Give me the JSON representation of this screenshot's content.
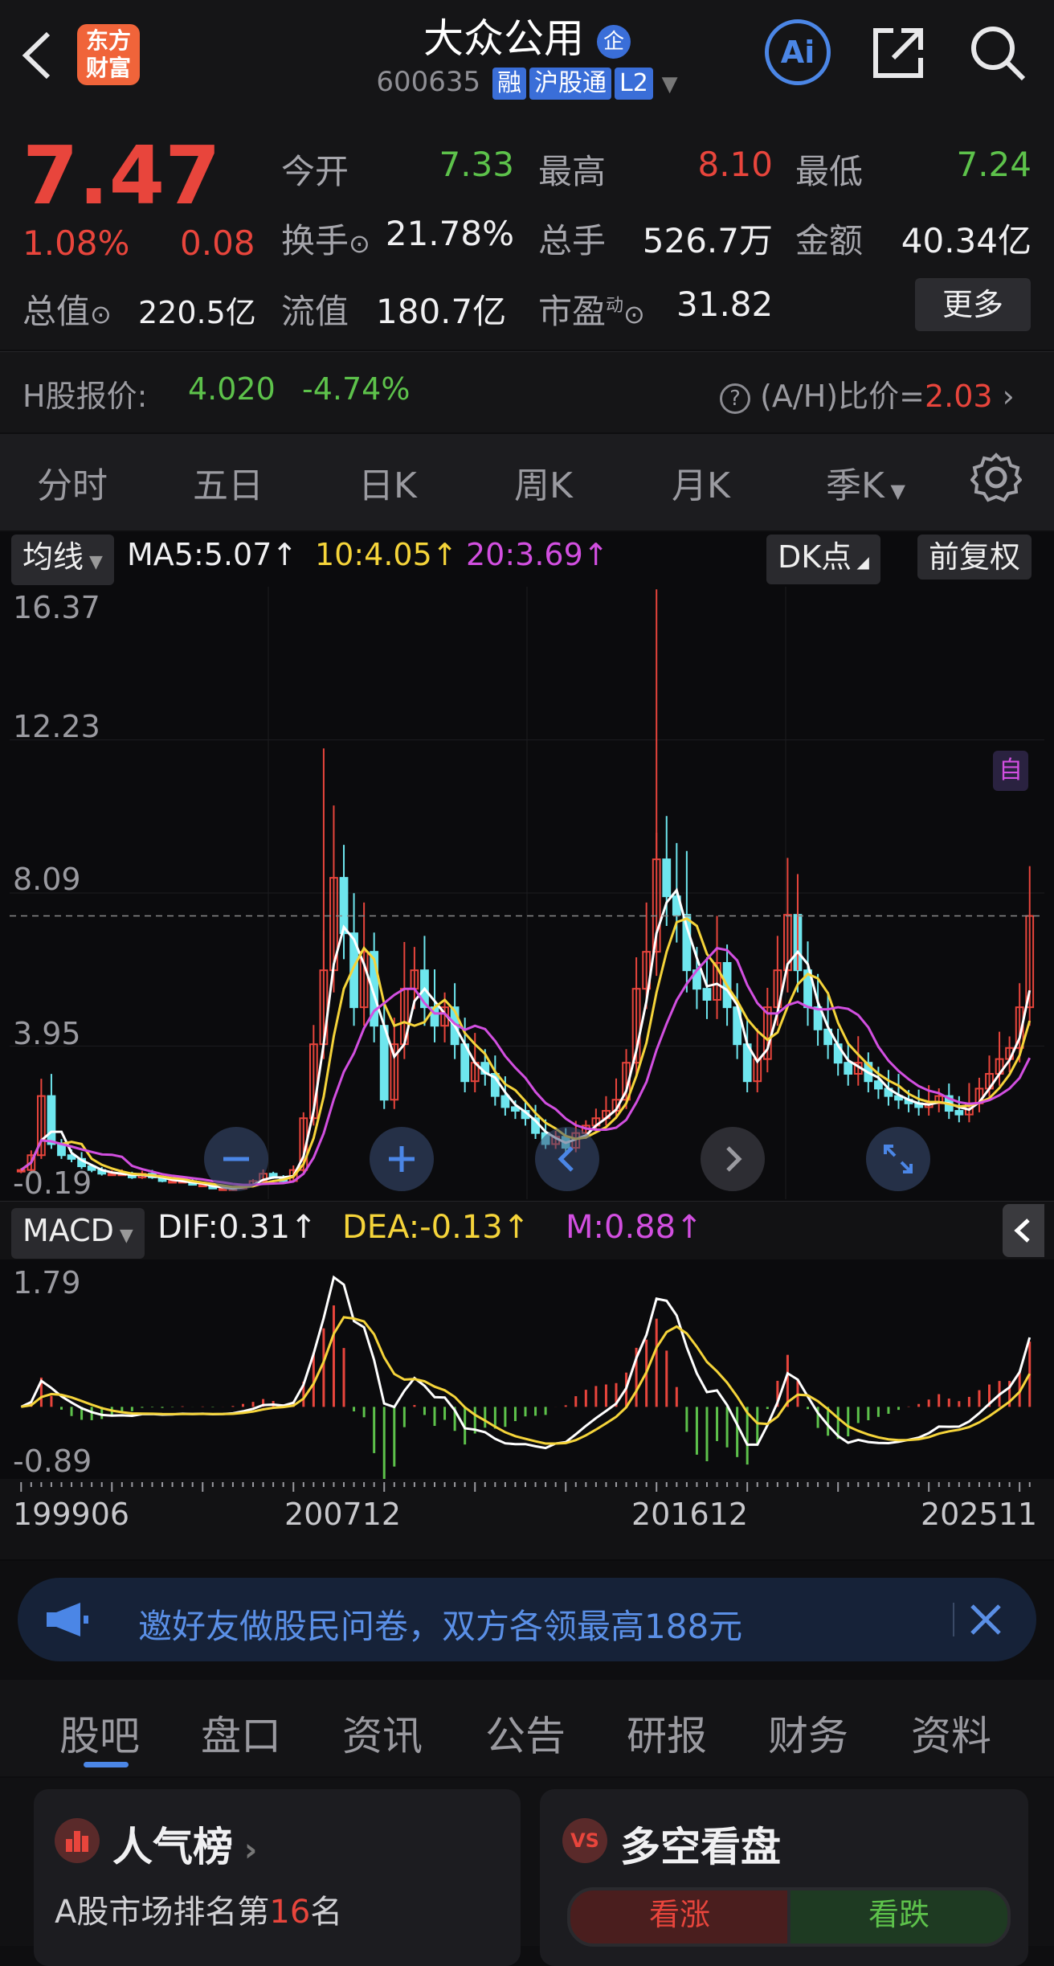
{
  "header": {
    "title": "大众公用",
    "title_badge": "企",
    "code": "600635",
    "tags": [
      "融",
      "沪股通",
      "L2"
    ],
    "logo_line1": "东方",
    "logo_line2": "财富",
    "ai_label": "Ai"
  },
  "quote": {
    "price": "7.47",
    "change_pct": "1.08%",
    "change": "0.08",
    "open_label": "今开",
    "open": "7.33",
    "high_label": "最高",
    "high": "8.10",
    "low_label": "最低",
    "low": "7.24",
    "turnover_label": "换手",
    "turnover": "21.78%",
    "volume_label": "总手",
    "volume": "526.7万",
    "amount_label": "金额",
    "amount": "40.34亿",
    "mcap_label": "总值",
    "mcap": "220.5亿",
    "float_label": "流值",
    "float": "180.7亿",
    "pe_label": "市盈",
    "pe_sup": "动",
    "pe": "31.82",
    "more": "更多"
  },
  "hshare": {
    "label": "H股报价:",
    "price": "4.020",
    "change": "-4.74%",
    "ratio_label": "(A/H)比价=",
    "ratio": "2.03"
  },
  "ktabs": [
    "分时",
    "五日",
    "日K",
    "周K",
    "月K",
    "季K"
  ],
  "ktab_active": "季K",
  "ma": {
    "selector": "均线",
    "ma5": "MA5:5.07",
    "ma10": "10:4.05",
    "ma20": "20:3.69",
    "dk": "DK点",
    "adjust": "前复权",
    "auto_tag": "自"
  },
  "price_axis": [
    "16.37",
    "12.23",
    "8.09",
    "3.95",
    "-0.19"
  ],
  "macd": {
    "selector": "MACD",
    "dif": "DIF:0.31",
    "dea": "DEA:-0.13",
    "m": "M:0.88",
    "axis_top": "1.79",
    "axis_bottom": "-0.89"
  },
  "date_axis": [
    "199906",
    "200712",
    "201612",
    "202511"
  ],
  "notice": {
    "text": "邀好友做股民问卷，双方各领最高188元"
  },
  "bottom_tabs": [
    "股吧",
    "盘口",
    "资讯",
    "公告",
    "研报",
    "财务",
    "资料"
  ],
  "bottom_tab_active": "股吧",
  "cards": {
    "popular_title": "人气榜",
    "popular_text_pre": "A股市场排名第",
    "popular_rank": "16",
    "popular_text_post": "名",
    "vs_title": "多空看盘",
    "vs_bull": "看涨",
    "vs_bear": "看跌",
    "vs_badge": "VS"
  },
  "colors": {
    "up": "#e8453c",
    "down": "#5dc24b",
    "accent": "#4b86e6",
    "ma10": "#f5d43a",
    "ma20": "#d24fe0"
  },
  "chart_data": {
    "type": "candlestick",
    "period": "quarterly",
    "title": "",
    "ylim": [
      -0.19,
      16.37
    ],
    "overlays": [
      "MA5",
      "MA10",
      "MA20"
    ],
    "x_ticks": [
      "199906",
      "200712",
      "201612",
      "202511"
    ],
    "close_series": [
      0.6,
      1.0,
      2.6,
      1.3,
      1.0,
      0.9,
      0.7,
      0.6,
      0.5,
      0.5,
      0.5,
      0.4,
      0.5,
      0.4,
      0.3,
      0.3,
      0.3,
      0.2,
      0.2,
      0.1,
      0.1,
      0.1,
      0.2,
      0.3,
      0.5,
      0.4,
      0.3,
      0.6,
      2.0,
      4.0,
      6.0,
      8.5,
      7.0,
      5.0,
      6.5,
      4.5,
      2.5,
      4.0,
      5.5,
      6.0,
      5.0,
      4.5,
      5.0,
      4.0,
      3.0,
      3.5,
      3.2,
      2.6,
      2.3,
      2.2,
      2.0,
      1.6,
      1.3,
      1.5,
      1.2,
      1.6,
      1.8,
      2.0,
      2.2,
      2.5,
      3.5,
      5.5,
      6.5,
      9.0,
      8.0,
      7.5,
      6.0,
      5.5,
      5.2,
      6.2,
      5.0,
      4.0,
      3.0,
      3.6,
      5.0,
      6.0,
      7.5,
      6.0,
      5.0,
      4.4,
      4.0,
      3.5,
      3.2,
      3.5,
      3.0,
      2.8,
      2.6,
      2.5,
      2.4,
      2.3,
      2.4,
      2.6,
      2.2,
      2.1,
      2.4,
      2.8,
      3.2,
      3.6,
      3.9,
      5.0,
      7.47
    ],
    "macd_ylim": [
      -0.89,
      1.79
    ],
    "dif": 0.31,
    "dea": -0.13,
    "m": 0.88
  }
}
